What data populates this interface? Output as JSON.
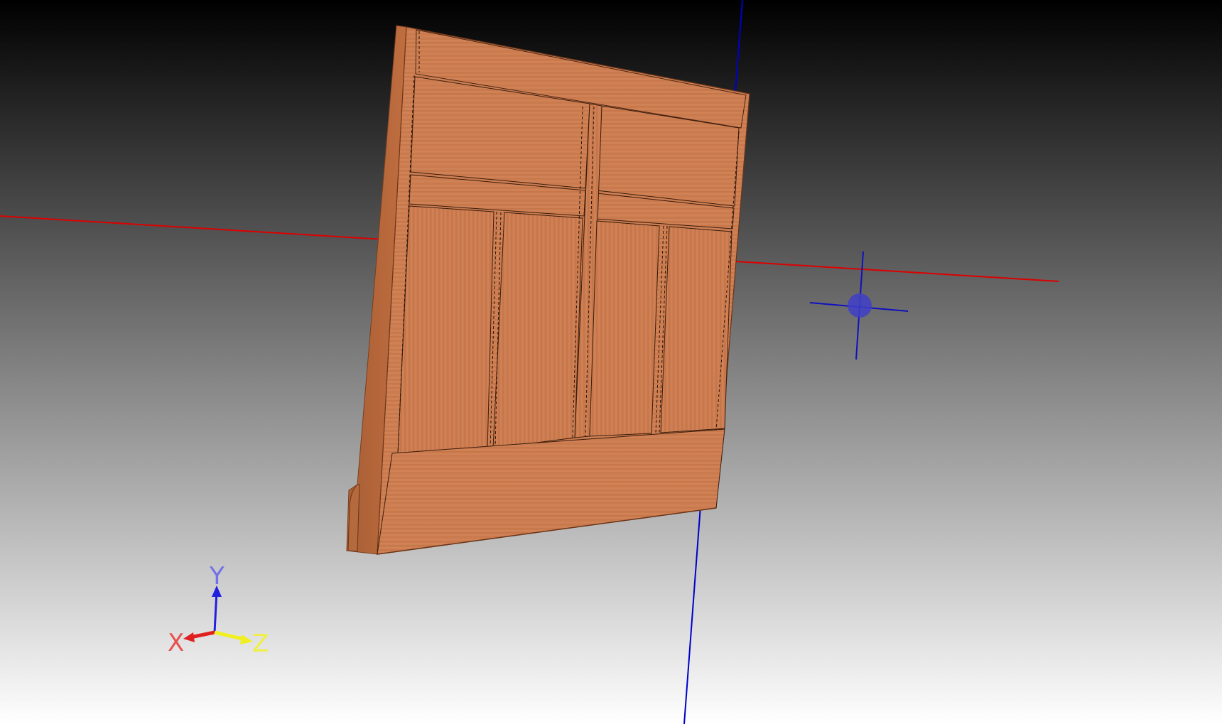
{
  "viewport": {
    "background_top": "#000000",
    "background_bottom": "#ffffff"
  },
  "axis_triad": {
    "x_label": "X",
    "y_label": "Y",
    "z_label": "Z",
    "x_color": "#e02020",
    "y_color": "#2020e0",
    "z_color": "#f0f020",
    "x_label_color": "#e85050",
    "y_label_color": "#7070e8",
    "z_label_color": "#f0f040"
  },
  "scene": {
    "red_axis_color": "#dd0000",
    "blue_axis_color": "#0000cc",
    "wood_color": "#c9794a",
    "wood_edge_color": "#9a5530",
    "pivot_color": "#4040c8",
    "model_icon": "wood-panel-icon",
    "pivot_icon": "crosshair-icon"
  }
}
